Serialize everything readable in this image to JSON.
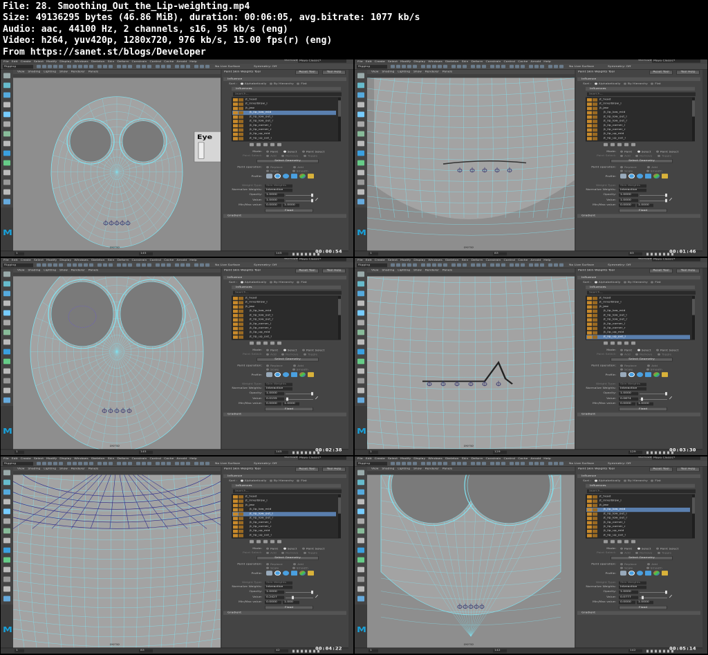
{
  "header": {
    "file_line": "File: 28. Smoothing_Out_the_Lip-weighting.mp4",
    "size_line": "Size: 49136295 bytes (46.86 MiB), duration: 00:06:05, avg.bitrate: 1077 kb/s",
    "audio_line": "Audio: aac, 44100 Hz, 2 channels, s16, 95 kb/s (eng)",
    "video_line": "Video: h264, yuv420p, 1280x720, 976 kb/s, 15.00 fps(r) (eng)",
    "from_line": "From https://sanet.st/blogs/Developer"
  },
  "ui": {
    "menus": [
      "File",
      "Edit",
      "Create",
      "Select",
      "Modify",
      "Display",
      "Windows",
      "Skeleton",
      "Skin",
      "Deform",
      "Constrain",
      "Control",
      "Cache",
      "Arnold",
      "Help"
    ],
    "viewport_menus": [
      "View",
      "Shading",
      "Lighting",
      "Show",
      "Renderer",
      "Panels"
    ],
    "workspace_label": "Workspace :",
    "workspace_value": "Maya Classic*",
    "mode_menu": "Rigging",
    "no_live_surface": "No Live Surface",
    "symmetry": "Symmetry: Off",
    "tool_title": "Paint Skin Weights Tool",
    "reset_tool": "Reset Tool",
    "tool_help": "Tool Help",
    "influence_section": "Influence",
    "influences_section": "Influences",
    "sort_label": "Sort :",
    "sort_alpha": "Alphabetically",
    "sort_hier": "By Hierarchy",
    "sort_flat": "Flat",
    "search_placeholder": "Search...",
    "mode_label": "Mode:",
    "mode_paint": "Paint",
    "mode_select": "Select",
    "mode_paint_select": "Paint Select",
    "paint_select_label": "Paint Select:",
    "ps_add": "Add",
    "ps_remove": "Remove",
    "ps_toggle": "Toggle",
    "select_geometry": "Select Geometry",
    "paint_operation_label": "Paint operation:",
    "op_replace": "Replace",
    "op_add": "Add",
    "op_scale": "Scale",
    "op_smooth": "Smooth",
    "profile_label": "Profile:",
    "weight_type_label": "Weight Type:",
    "weight_type_value": "Skin Weights",
    "normalize_label": "Normalize Weights:",
    "normalize_value": "Interactive",
    "opacity_label": "Opacity:",
    "value_label": "Value:",
    "minmax_label": "Min/Max value:",
    "flood": "Flood",
    "gradient_section": "Gradient",
    "persp": "persp",
    "eye_label": "Eye"
  },
  "tiles": [
    {
      "timestamp": "00:00:54",
      "frame_left": "145",
      "frame_right": "145",
      "opacity": "1.0000",
      "value": "1.0000",
      "minmax": [
        "0.0000",
        "1.0000"
      ],
      "influences": [
        "jt_head",
        "jt_innerBrow_l",
        "jt_jaw",
        "jt_lip_low_mid",
        "jt_lip_low_out_l",
        "jt_lip_low_out_r",
        "jt_lip_corner_l",
        "jt_lip_corner_r",
        "jt_lip_up_mid",
        "jt_lip_up_out_l"
      ],
      "selected_index": 3
    },
    {
      "timestamp": "00:01:46",
      "frame_left": "83",
      "frame_right": "83",
      "opacity": "1.0000",
      "value": "1.0000",
      "minmax": [
        "0.0000",
        "1.0000"
      ],
      "influences": [
        "jt_head",
        "jt_innerBrow_l",
        "jt_jaw",
        "jt_lip_low_mid",
        "jt_lip_low_out_l",
        "jt_lip_low_out_r",
        "jt_lip_corner_l",
        "jt_lip_corner_r",
        "jt_lip_up_mid",
        "jt_lip_up_out_l"
      ],
      "selected_index": -1
    },
    {
      "timestamp": "00:02:38",
      "frame_left": "145",
      "frame_right": "145",
      "opacity": "1.0000",
      "value": "0.0155",
      "minmax": [
        "0.0000",
        "1.0000"
      ],
      "influences": [
        "jt_head",
        "jt_innerBrow_l",
        "jt_jaw",
        "jt_lip_low_mid",
        "jt_lip_low_out_l",
        "jt_lip_low_out_r",
        "jt_lip_corner_l",
        "jt_lip_corner_r",
        "jt_lip_up_mid",
        "jt_lip_up_out_l"
      ],
      "selected_index": -1
    },
    {
      "timestamp": "00:03:30",
      "frame_left": "129",
      "frame_right": "129",
      "opacity": "1.0000",
      "value": "0.0674",
      "minmax": [
        "0.0000",
        "1.0000"
      ],
      "influences": [
        "jt_head",
        "jt_innerBrow_l",
        "jt_jaw",
        "jt_lip_low_mid",
        "jt_lip_low_out_l",
        "jt_lip_low_out_r",
        "jt_lip_corner_l",
        "jt_lip_corner_r",
        "jt_lip_up_mid",
        "jt_lip_up_out_l"
      ],
      "selected_index": 9
    },
    {
      "timestamp": "00:04:22",
      "frame_left": "83",
      "frame_right": "42",
      "opacity": "1.0000",
      "value": "0.2427",
      "minmax": [
        "0.0000",
        "1.000"
      ],
      "influences": [
        "jt_head",
        "jt_innerBrow_l",
        "jt_jaw",
        "jt_lip_low_mid",
        "jt_lip_low_out_l",
        "jt_lip_low_out_r",
        "jt_lip_corner_l",
        "jt_lip_corner_r",
        "jt_lip_up_mid",
        "jt_lip_up_out_l"
      ],
      "selected_index": 4
    },
    {
      "timestamp": "00:05:14",
      "frame_left": "142",
      "frame_right": "142",
      "opacity": "1.0000",
      "value": "0.0777",
      "minmax": [
        "0.0000",
        "1.0000"
      ],
      "influences": [
        "jt_head",
        "jt_innerBrow_l",
        "jt_jaw",
        "jt_lip_low_mid",
        "jt_lip_low_out_l",
        "jt_lip_low_out_r",
        "jt_lip_corner_l",
        "jt_lip_corner_r",
        "jt_lip_up_mid",
        "jt_lip_up_out_l"
      ],
      "selected_index": 3
    }
  ],
  "colors": {
    "accent": "#5a7fae",
    "wire": "#7fe6f5",
    "maya_logo": "#19a0d8",
    "lock": "#c98a2a"
  },
  "icons": [
    "select-tool-icon",
    "lasso-icon",
    "paint-icon",
    "move-icon",
    "rotate-icon",
    "scale-icon",
    "smooth-profile-icon",
    "gaussian-profile-icon",
    "square-profile-icon",
    "folder-icon"
  ]
}
